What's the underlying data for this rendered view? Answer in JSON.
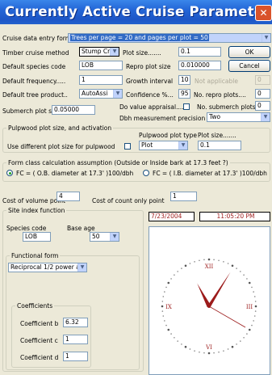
{
  "window": {
    "title": "Currently Active Cruise Parameters",
    "close_glyph": "✕",
    "colors": {
      "titlebar": "#2466d7",
      "close": "#d9532b",
      "face": "#ece9d8",
      "clock_accent": "#9c1b1b"
    }
  },
  "form": {
    "cruise_data_entry_label": "Cruise data entry form",
    "cruise_data_entry_value": "Trees per page = 20 and pages per plot = 50",
    "timber_method_label": "Timber cruise method",
    "timber_method_value": "Stump Cr",
    "plot_size_label": "Plot size.......",
    "plot_size_value": "0.1",
    "default_species_label": "Default species code",
    "default_species_value": "LOB",
    "repro_plot_size_label": "Repro plot size",
    "repro_plot_size_value": "0.010000",
    "default_frequency_label": "Default frequency.....",
    "default_frequency_value": "1",
    "growth_interval_label": "Growth interval",
    "growth_interval_value": "10",
    "not_applicable_label": "Not applicable",
    "not_applicable_value": "0",
    "default_tree_product_label": "Default tree product..",
    "default_tree_product_value": "AutoAssi",
    "confidence_label": "Confidence %...",
    "confidence_value": "95",
    "no_repro_plots_label": "No. repro plots....",
    "no_repro_plots_value": "0",
    "submerch_plot_size_label": "Submerch plot size",
    "submerch_plot_size_value": "0.05000",
    "do_value_appraisal_label": "Do value appraisal.....",
    "no_submerch_plots_label": "No. submerch plots",
    "no_submerch_plots_value": "0",
    "dbh_precision_label": "Dbh measurement precision",
    "dbh_precision_value": "Two"
  },
  "pulpwood": {
    "group_title": "Pulpwood plot size, and activation",
    "use_different_label": "Use different plot size for pulpwood",
    "plot_type_label": "Pulpwood plot type",
    "plot_type_value": "Plot",
    "plot_size_label": "Plot size.......",
    "plot_size_value": "0.1"
  },
  "form_class": {
    "group_title": "Form class calculation assumption (Outside or Inside bark at 17.3 feet ?)",
    "option_outside": "FC = ( O.B. diameter at 17.3' )100/dbh",
    "option_inside": "FC = ( I.B. diameter at 17.3' )100/dbh",
    "selected": "outside"
  },
  "costs": {
    "volume_point_label": "Cost of volume point",
    "volume_point_value": "4",
    "count_only_point_label": "Cost of count only point",
    "count_only_point_value": "1"
  },
  "site_index": {
    "group_title": "Site index function",
    "species_code_label": "Species code",
    "species_code_value": "LOB",
    "base_age_label": "Base age",
    "base_age_value": "50",
    "functional_form_title": "Functional form",
    "functional_form_value": "Reciprocal 1/2 power age",
    "coefficients_title": "Coefficients",
    "coef_b_label": "Coefficient b",
    "coef_b_value": "6.32",
    "coef_c_label": "Coefficient c",
    "coef_c_value": "1",
    "coef_d_label": "Coefficient d",
    "coef_d_value": "1"
  },
  "buttons": {
    "ok": "OK",
    "cancel": "Cancel"
  },
  "clock": {
    "date": "7/23/2004",
    "time": "11:05:20 PM",
    "numerals": {
      "top": "XII",
      "left": "IX",
      "right": "III",
      "bottom": "VI"
    },
    "hour": 11,
    "minute": 5,
    "second": 20
  }
}
